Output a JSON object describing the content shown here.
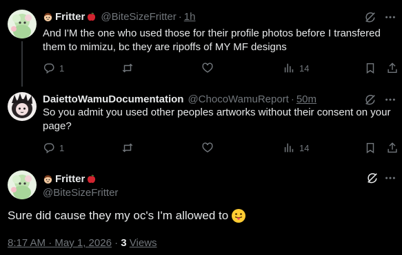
{
  "reply1": {
    "display_name": "Fritter",
    "handle": "@BiteSizeFritter",
    "separator": "·",
    "time": "1h",
    "text": "And I'M the one who used those for their profile photos before I transfered them to mimizu, bc they are ripoffs of MY MF designs",
    "replies": "1",
    "reposts": "",
    "likes": "",
    "views": "14"
  },
  "reply2": {
    "display_name": "DaiettoWamuDocumentation",
    "handle": "@ChocoWamuReport",
    "separator": "·",
    "time": "50m",
    "text": "So you admit you used other peoples artworks without their consent on your page?",
    "replies": "1",
    "reposts": "",
    "likes": "",
    "views": "14"
  },
  "main": {
    "display_name": "Fritter",
    "handle": "@BiteSizeFritter",
    "text": "Sure did cause they my oc's I'm allowed to",
    "timestamp": "8:17 AM · May 1, 2026",
    "separator": "·",
    "views_count": "3",
    "views_label": "Views"
  },
  "icons": {
    "reply": "reply-icon",
    "repost": "repost-icon",
    "like": "heart-icon",
    "views": "views-icon",
    "bookmark": "bookmark-icon",
    "share": "share-icon",
    "grok": "grok-icon",
    "more": "more-icon",
    "emoji_face": "face-emoji",
    "emoji_apple": "apple-emoji",
    "emoji_tongue": "tongue-out-emoji"
  },
  "colors": {
    "background": "#000000",
    "text": "#e7e9ea",
    "secondary": "#71767b",
    "thread_line": "#333639",
    "apple": "#d1242f"
  }
}
